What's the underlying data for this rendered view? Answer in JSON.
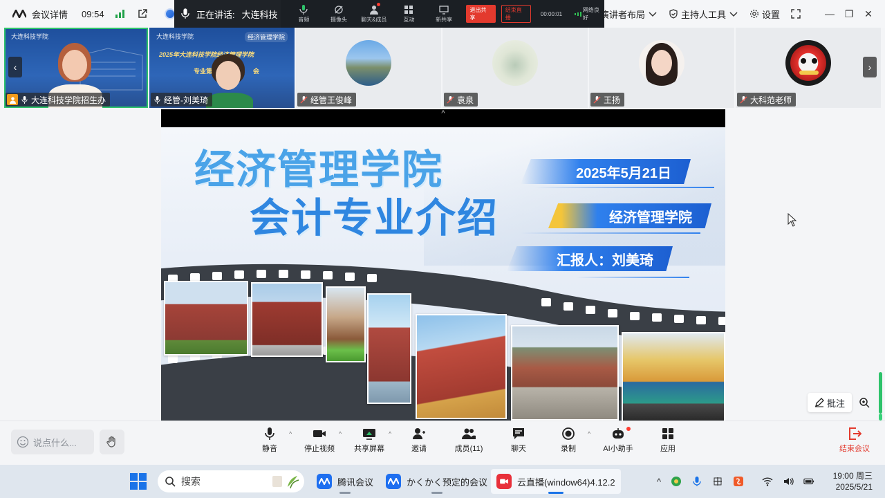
{
  "titlebar": {
    "meeting_details": "会议详情",
    "time": "09:54",
    "cut_text": "经",
    "speaking_label": "正在讲话:",
    "speaking_name": "大连科技",
    "presenter_layout": "演讲者布局",
    "host_tools": "主持人工具",
    "settings": "设置"
  },
  "floatbar": {
    "items": [
      {
        "label": "音频",
        "icon": "mic-icon"
      },
      {
        "label": "摄像头",
        "icon": "camera-off-icon"
      },
      {
        "label": "聊天&成员",
        "icon": "members-icon"
      },
      {
        "label": "互动",
        "icon": "grid-icon"
      },
      {
        "label": "新共享",
        "icon": "share-icon"
      }
    ],
    "exit_share": "退出共享",
    "live": "结束直播",
    "timer": "00:00:01",
    "network": "网络良好"
  },
  "participants": [
    {
      "name": "大连科技学院招生办",
      "school": "大连科技学院",
      "host": true,
      "type": "video",
      "active": true
    },
    {
      "name": "经管-刘美琦",
      "school": "大连科技学院",
      "badge": "经济管理学院",
      "poster_line1": "2025年大连科技学院经济管理学院",
      "poster_line2": "专业第",
      "poster_line3": "会",
      "type": "video"
    },
    {
      "name": "经管王俊峰",
      "type": "avatar",
      "avatar": "landscape"
    },
    {
      "name": "袁泉",
      "type": "avatar",
      "avatar": "painting"
    },
    {
      "name": "王扬",
      "type": "avatar",
      "avatar": "girl"
    },
    {
      "name": "大科范老师",
      "type": "avatar",
      "avatar": "lion"
    }
  ],
  "slide": {
    "title_line1": "经济管理学院",
    "title_line2": "会计专业介绍",
    "date": "2025年5月21日",
    "department": "经济管理学院",
    "presenter": "汇报人：刘美琦"
  },
  "stage": {
    "annotate": "批注"
  },
  "toolbar": {
    "chat_placeholder": "说点什么...",
    "tools": [
      {
        "label": "静音",
        "icon": "mic-icon",
        "caret": true
      },
      {
        "label": "停止视频",
        "icon": "video-icon",
        "caret": true
      },
      {
        "label": "共享屏幕",
        "icon": "share-screen-icon",
        "caret": true
      },
      {
        "label": "邀请",
        "icon": "invite-icon"
      },
      {
        "label": "成员(11)",
        "icon": "members-icon"
      },
      {
        "label": "聊天",
        "icon": "chat-icon"
      },
      {
        "label": "录制",
        "icon": "record-icon",
        "caret": true
      },
      {
        "label": "AI小助手",
        "icon": "ai-assistant-icon",
        "dot": true
      },
      {
        "label": "应用",
        "icon": "apps-icon"
      }
    ],
    "end_meeting": "结束会议"
  },
  "taskbar": {
    "search_placeholder": "搜索",
    "apps": [
      {
        "label": "腾讯会议",
        "icon": "tencent-meeting-icon"
      },
      {
        "label": "かくかく预定的会议",
        "icon": "tencent-meeting-icon"
      },
      {
        "label": "云直播(window64)4.12.2",
        "icon": "cloud-live-icon"
      }
    ],
    "clock_time": "19:00 周三",
    "clock_date": "2025/5/21"
  },
  "colors": {
    "accent_green": "#2ec36b",
    "danger_red": "#e33a2e",
    "slide_blue": "#2f80ed",
    "host_orange": "#f29b1c"
  }
}
